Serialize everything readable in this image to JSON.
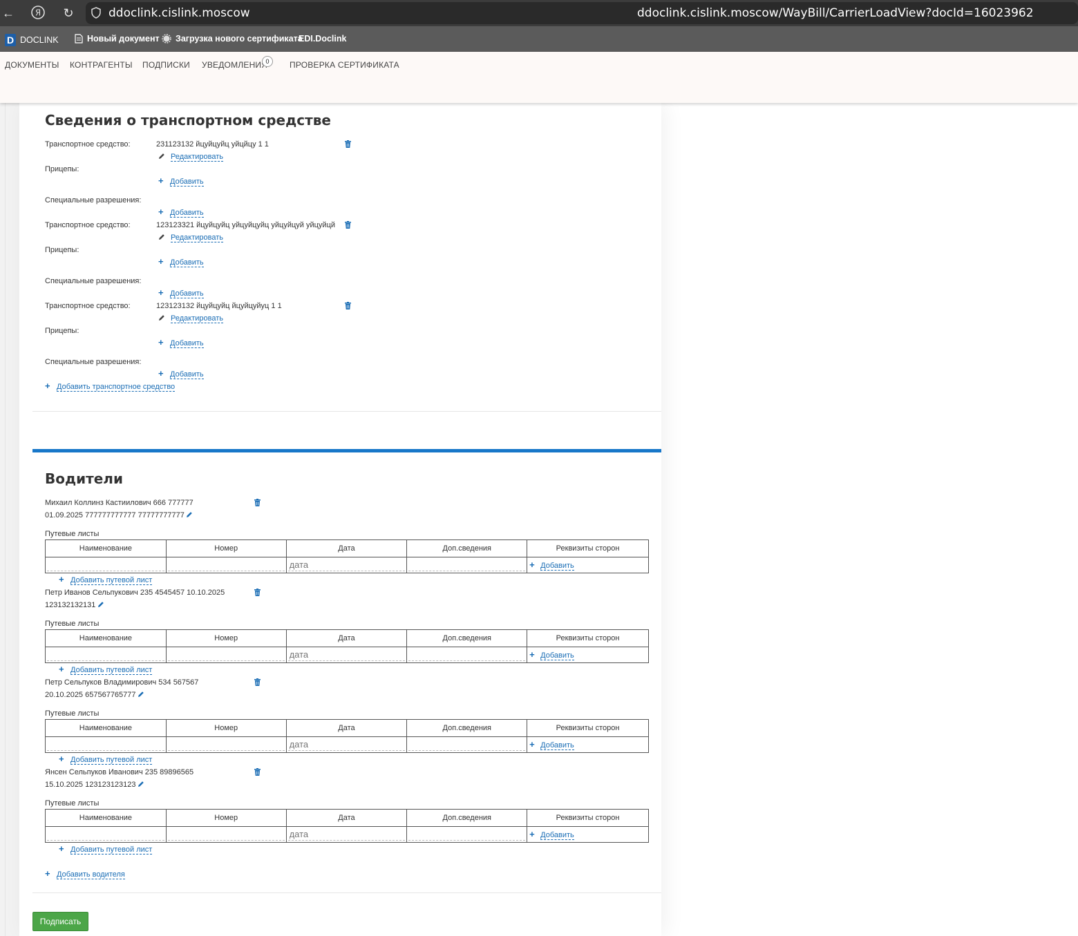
{
  "browser": {
    "host": "ddoclink.cislink.moscow",
    "url": "ddoclink.cislink.moscow/WayBill/CarrierLoadView?docId=16023962"
  },
  "bookmarks": [
    {
      "label": "DOCLINK"
    },
    {
      "label": "Новый документ"
    },
    {
      "label": "Загрузка нового сертификата"
    },
    {
      "label": "EDI.Doclink"
    }
  ],
  "menu": {
    "documents": "ДОКУМЕНТЫ",
    "contractors": "КОНТРАГЕНТЫ",
    "subscriptions": "ПОДПИСКИ",
    "notifications": "УВЕДОМЛЕНИЯ",
    "notifications_count": "0",
    "cert_check": "ПРОВЕРКА СЕРТИФИКАТА"
  },
  "vehicles_section": {
    "title": "Сведения о транспортном средстве",
    "vehicle_label": "Транспортное средство:",
    "trailers_label": "Прицепы:",
    "permits_label": "Специальные разрешения:",
    "edit_label": "Редактировать",
    "add_label": "Добавить",
    "add_vehicle_label": "Добавить транспортное средство",
    "vehicles": [
      {
        "name": "231123132 йцуйцуйц уйцйцу 1 1"
      },
      {
        "name": "123123321 йцуйцуйц уйцуйцуйц уйцуйцуй уйцуйцй"
      },
      {
        "name": "123123132 йцуйцуйц йцуйцуйуц 1 1"
      }
    ]
  },
  "drivers_section": {
    "title": "Водители",
    "waybills_label": "Путевые листы",
    "add_waybill_label": "Добавить путевой лист",
    "add_driver_label": "Добавить водителя",
    "add_label": "Добавить",
    "date_placeholder": "дата",
    "columns": [
      "Наименование",
      "Номер",
      "Дата",
      "Доп.сведения",
      "Реквизиты сторон"
    ],
    "drivers": [
      {
        "line1": "Михаил Коллинз Кастиилович 666 777777",
        "line2": "01.09.2025 777777777777 77777777777"
      },
      {
        "line1": "Петр Иванов Сельпукович 235 4545457 10.10.2025",
        "line2": "123132132131"
      },
      {
        "line1": "Петр Сельпуков Владимирович 534 567567",
        "line2": "20.10.2025 657567765777"
      },
      {
        "line1": "Янсен Сельпуков Иванович 235 89896565",
        "line2": "15.10.2025 123123123123"
      }
    ]
  },
  "sign_button": "Подписать",
  "colors": {
    "accent": "#1877c9",
    "link": "#1a6db5",
    "sign": "#4ca648"
  }
}
